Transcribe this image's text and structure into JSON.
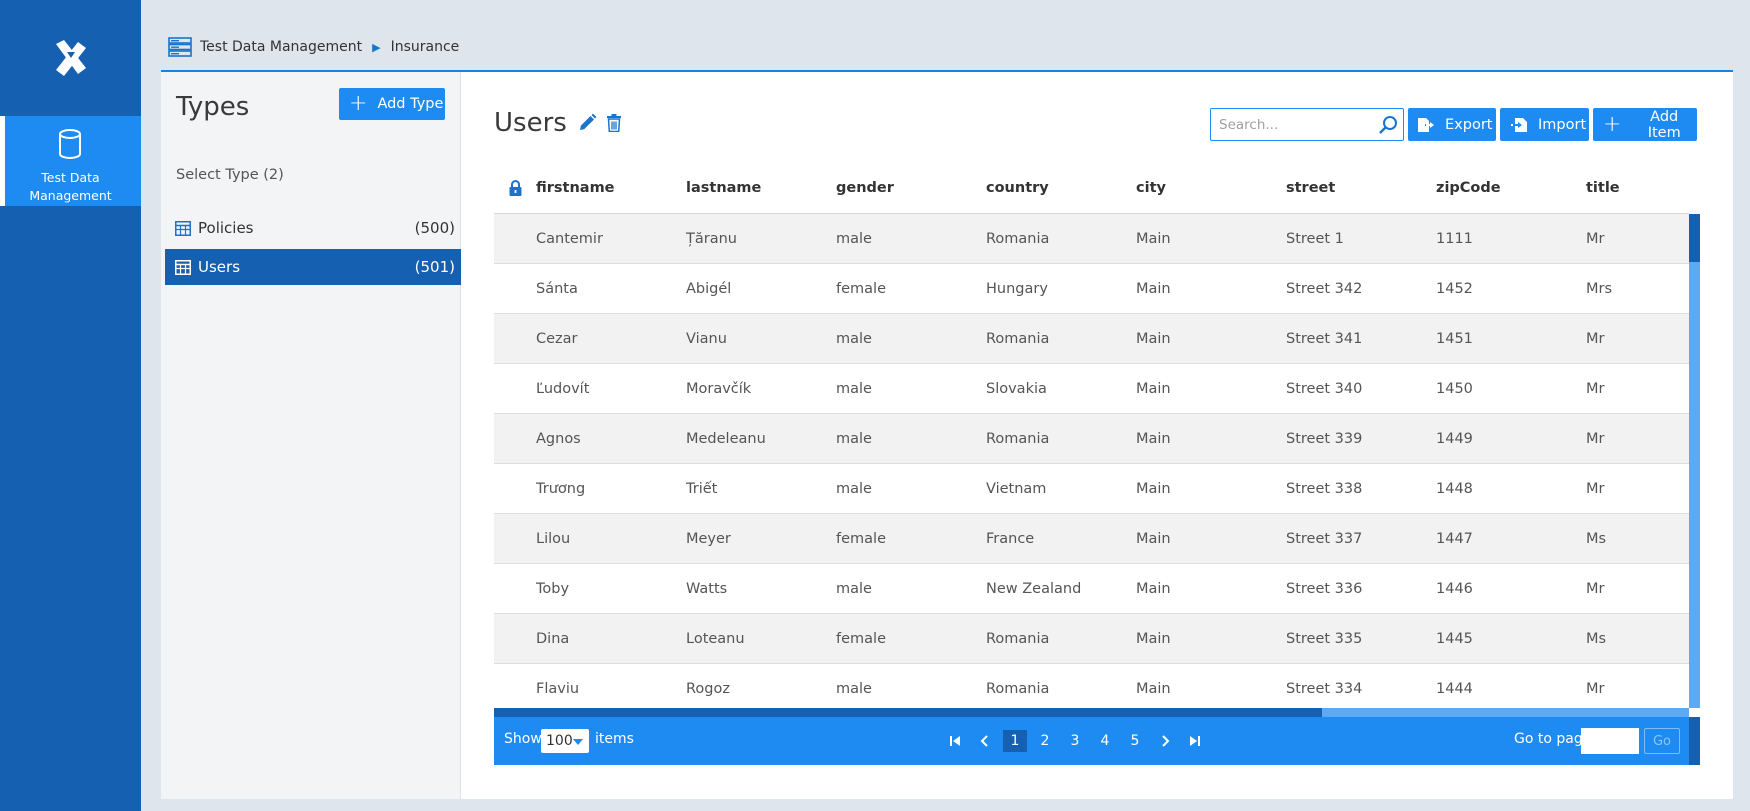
{
  "sidebar": {
    "active_item_label_line1": "Test Data",
    "active_item_label_line2": "Management"
  },
  "breadcrumb": {
    "root": "Test Data Management",
    "current": "Insurance"
  },
  "types_panel": {
    "title": "Types",
    "add_button": "Add Type",
    "select_label": "Select Type (2)",
    "items": [
      {
        "label": "Policies",
        "count": "(500)",
        "active": false
      },
      {
        "label": "Users",
        "count": "(501)",
        "active": true
      }
    ]
  },
  "main": {
    "title": "Users",
    "search_placeholder": "Search...",
    "export_label": "Export",
    "import_label": "Import",
    "add_item_label": "Add Item"
  },
  "table": {
    "columns": [
      "firstname",
      "lastname",
      "gender",
      "country",
      "city",
      "street",
      "zipCode",
      "title"
    ],
    "rows": [
      [
        "Cantemir",
        "Țăranu",
        "male",
        "Romania",
        "Main",
        "Street 1",
        "1111",
        "Mr"
      ],
      [
        "Sánta",
        "Abigél",
        "female",
        "Hungary",
        "Main",
        "Street 342",
        "1452",
        "Mrs"
      ],
      [
        "Cezar",
        "Vianu",
        "male",
        "Romania",
        "Main",
        "Street 341",
        "1451",
        "Mr"
      ],
      [
        "Ľudovít",
        "Moravčík",
        "male",
        "Slovakia",
        "Main",
        "Street 340",
        "1450",
        "Mr"
      ],
      [
        "Agnos",
        "Medeleanu",
        "male",
        "Romania",
        "Main",
        "Street 339",
        "1449",
        "Mr"
      ],
      [
        "Trương",
        "Triết",
        "male",
        "Vietnam",
        "Main",
        "Street 338",
        "1448",
        "Mr"
      ],
      [
        "Lilou",
        "Meyer",
        "female",
        "France",
        "Main",
        "Street 337",
        "1447",
        "Ms"
      ],
      [
        "Toby",
        "Watts",
        "male",
        "New Zealand",
        "Main",
        "Street 336",
        "1446",
        "Mr"
      ],
      [
        "Dina",
        "Loteanu",
        "female",
        "Romania",
        "Main",
        "Street 335",
        "1445",
        "Ms"
      ],
      [
        "Flaviu",
        "Rogoz",
        "male",
        "Romania",
        "Main",
        "Street 334",
        "1444",
        "Mr"
      ]
    ]
  },
  "pager": {
    "show_label": "Show",
    "page_size": "100",
    "items_label": "items",
    "pages": [
      "1",
      "2",
      "3",
      "4",
      "5"
    ],
    "current_page": "1",
    "goto_label": "Go to page",
    "go_button": "Go"
  },
  "colors": {
    "rail": "#1560b0",
    "accent": "#1d8bf2",
    "active_row": "#1560b0",
    "scroll_track": "#5eaaf2"
  }
}
